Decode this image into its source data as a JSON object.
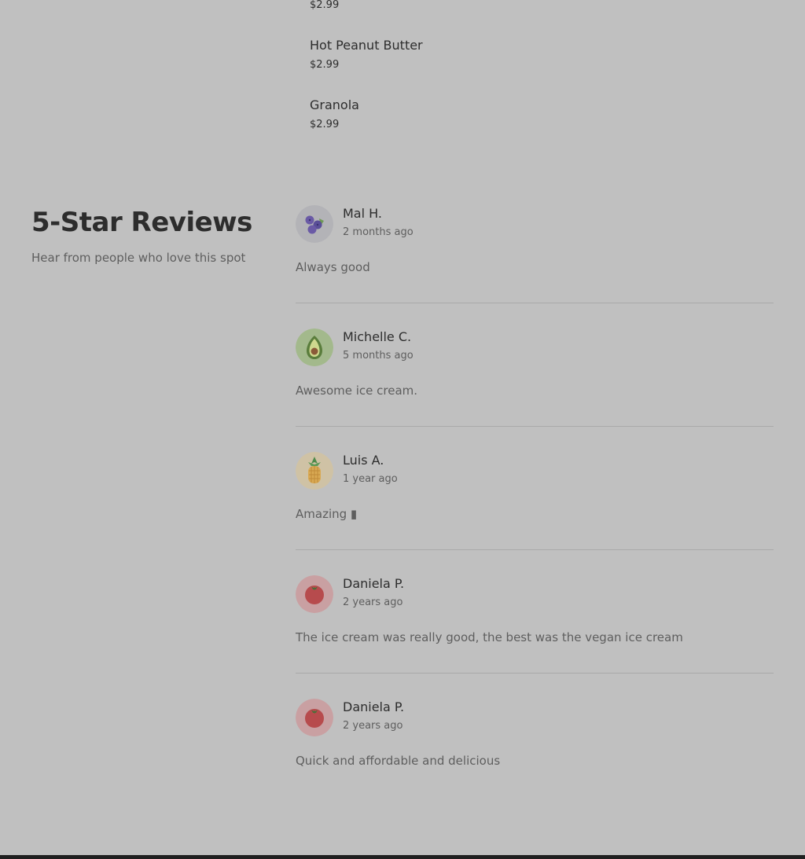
{
  "menu": {
    "items": [
      {
        "name": "",
        "price": "$2.99"
      },
      {
        "name": "Hot Peanut Butter",
        "price": "$2.99"
      },
      {
        "name": "Granola",
        "price": "$2.99"
      }
    ]
  },
  "reviews_section": {
    "title": "5-Star Reviews",
    "subtitle": "Hear from people who love this spot",
    "reviews": [
      {
        "name": "Mal H.",
        "date": "2 months ago",
        "text": "Always good",
        "avatar": "blueberry-icon"
      },
      {
        "name": "Michelle C.",
        "date": "5 months ago",
        "text": "Awesome ice cream.",
        "avatar": "avocado-icon"
      },
      {
        "name": "Luis A.",
        "date": "1 year ago",
        "text": "Amazing ▮",
        "avatar": "pineapple-icon"
      },
      {
        "name": "Daniela P.",
        "date": "2 years ago",
        "text": "The ice cream was really good, the best was the vegan ice cream",
        "avatar": "tomato-icon"
      },
      {
        "name": "Daniela P.",
        "date": "2 years ago",
        "text": "Quick and affordable and delicious",
        "avatar": "tomato-icon"
      }
    ]
  },
  "colors": {
    "background": "#c0c0c0",
    "text_primary": "#2d2d2d",
    "text_secondary": "#5e5e5e",
    "divider": "#a9a9a9",
    "footer": "#1f1f1f"
  }
}
